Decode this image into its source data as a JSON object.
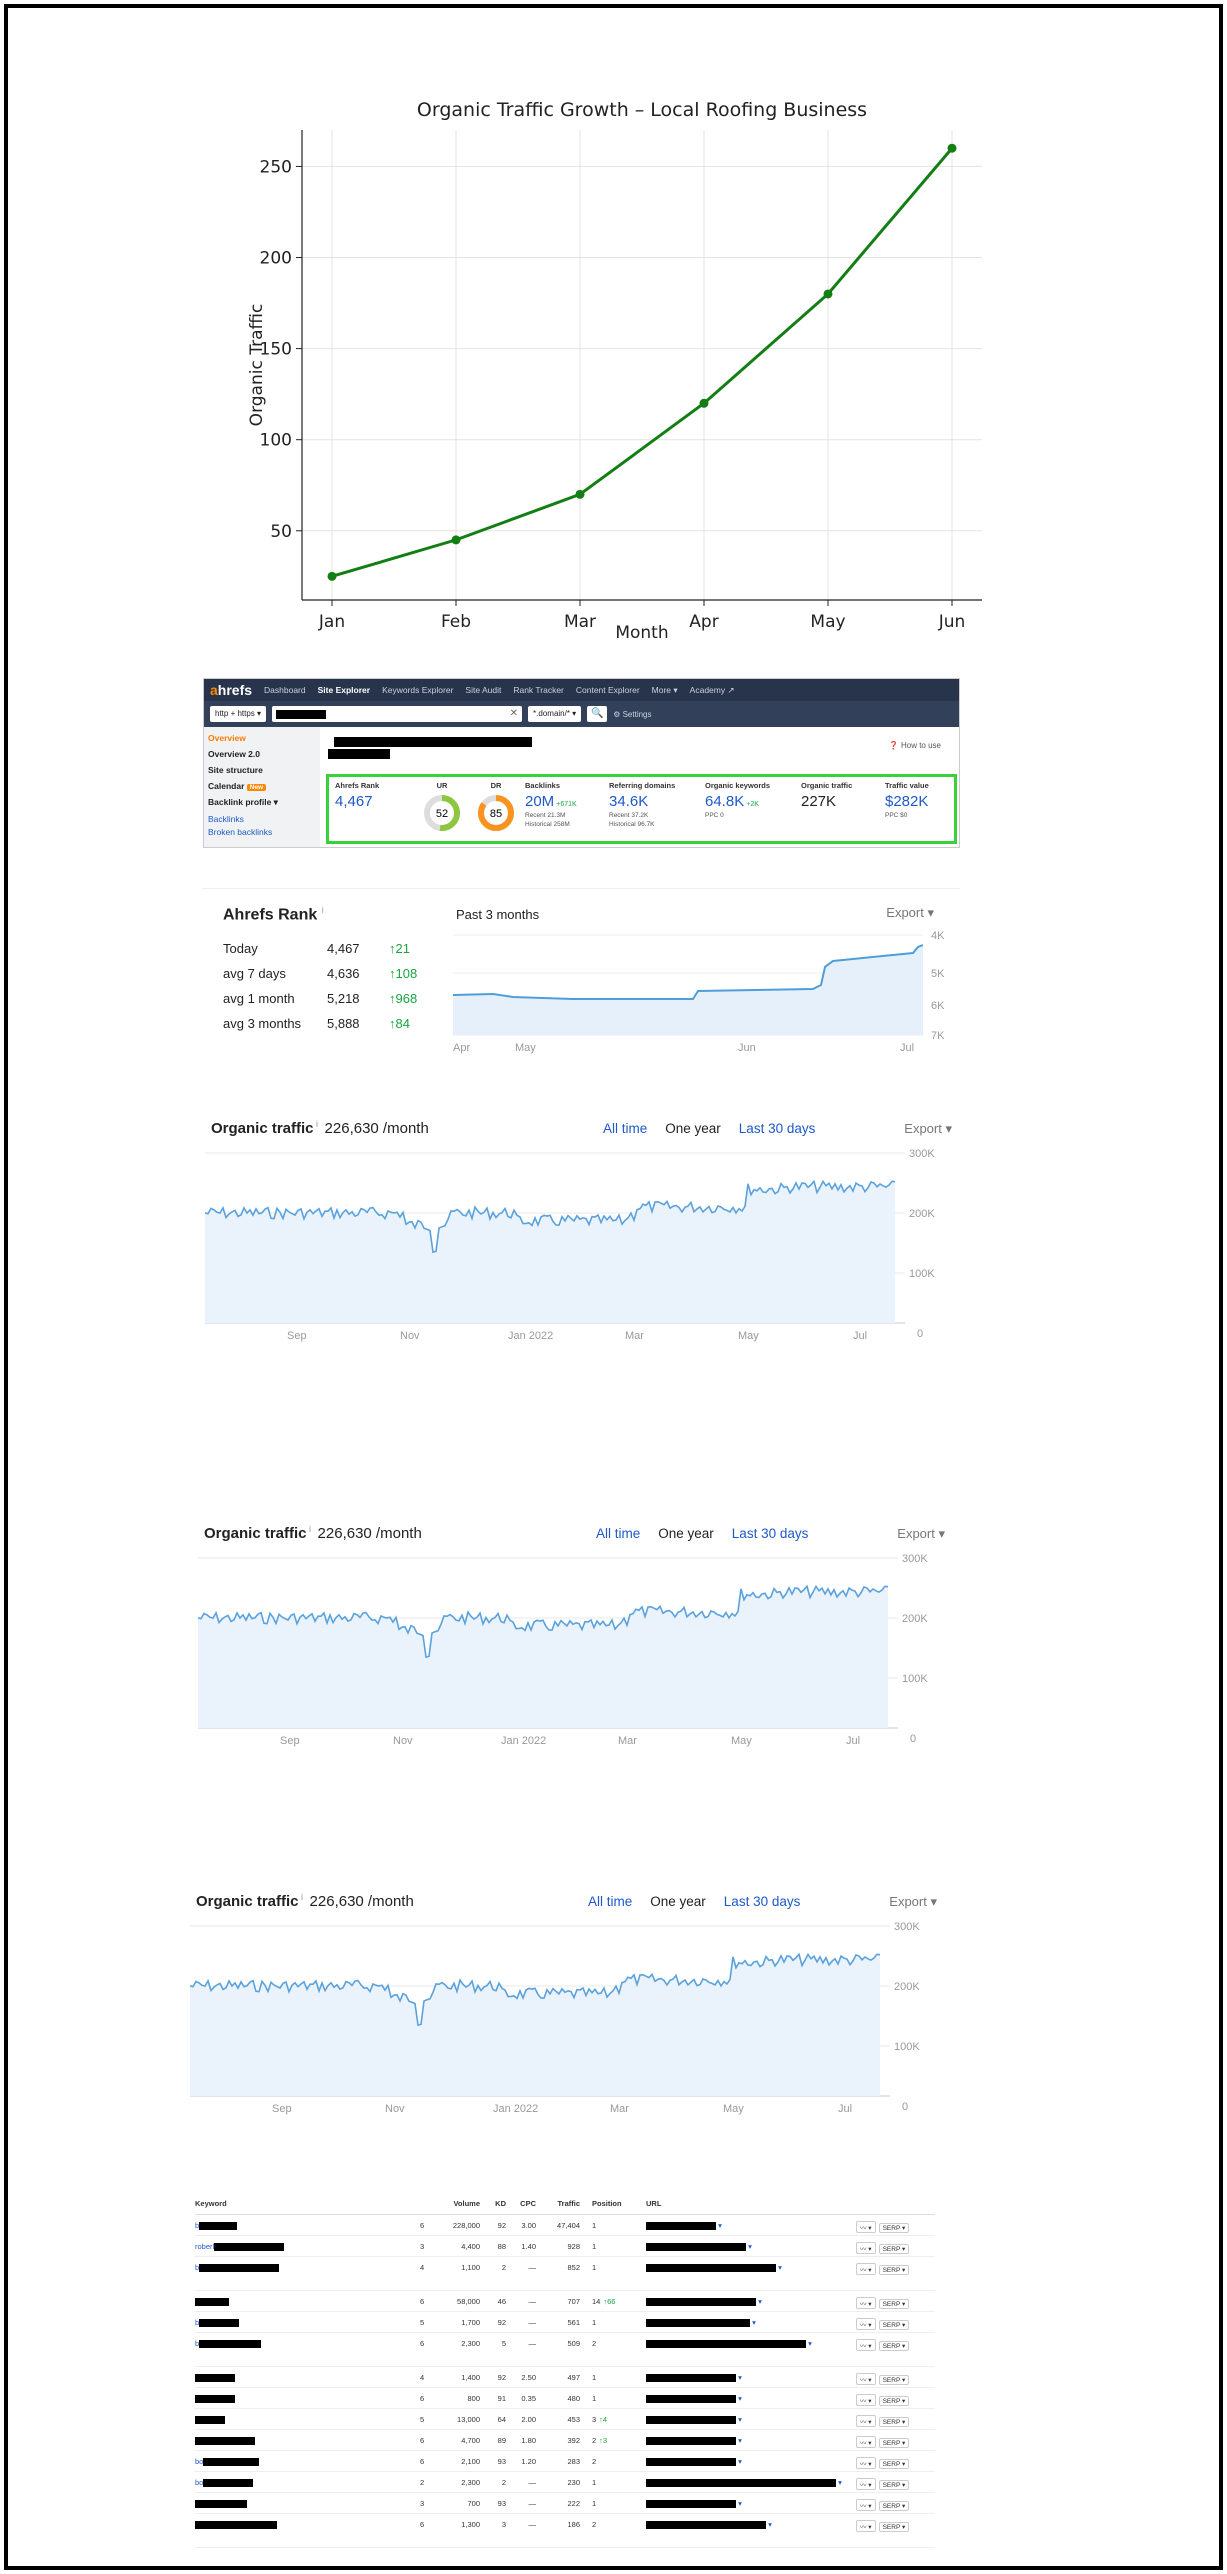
{
  "chart_data": {
    "type": "line",
    "title": "Organic Traffic Growth – Local Roofing Business",
    "xlabel": "Month",
    "ylabel": "Organic Traffic",
    "categories": [
      "Jan",
      "Feb",
      "Mar",
      "Apr",
      "May",
      "Jun"
    ],
    "values": [
      25,
      45,
      70,
      120,
      180,
      260
    ],
    "yticks": [
      50,
      100,
      150,
      200,
      250
    ],
    "ylim": [
      12,
      270
    ],
    "grid": true,
    "color": "#137e13"
  },
  "ahrefs": {
    "logo_a": "a",
    "logo_rest": "hrefs",
    "nav": [
      "Dashboard",
      "Site Explorer",
      "Keywords Explorer",
      "Site Audit",
      "Rank Tracker",
      "Content Explorer",
      "More ▾",
      "Academy ↗"
    ],
    "protocol": "http + https ▾",
    "mode": "*.domain/* ▾",
    "settings": "⚙ Settings",
    "how_to_use": "❓ How to use",
    "sidebar": [
      "Overview",
      "Overview 2.0",
      "Site structure",
      "Calendar",
      "Backlink profile ▾",
      "Backlinks",
      "Broken backlinks"
    ],
    "new_badge": "New",
    "metrics": {
      "ahrefs_rank": {
        "label": "Ahrefs Rank",
        "value": "4,467"
      },
      "ur": {
        "label": "UR",
        "value": "52"
      },
      "dr": {
        "label": "DR",
        "value": "85"
      },
      "backlinks": {
        "label": "Backlinks",
        "value": "20M",
        "delta": "+671K",
        "recent": "Recent 21.3M",
        "historical": "Historical 258M"
      },
      "ref_domains": {
        "label": "Referring domains",
        "value": "34.6K",
        "recent": "Recent 37.2K",
        "historical": "Historical 96.7K"
      },
      "org_keywords": {
        "label": "Organic keywords",
        "value": "64.8K",
        "delta": "+2K",
        "ppc": "PPC 0"
      },
      "org_traffic": {
        "label": "Organic traffic",
        "value": "227K"
      },
      "traffic_value": {
        "label": "Traffic value",
        "value": "$282K",
        "ppc": "PPC $0"
      }
    }
  },
  "rank": {
    "title": "Ahrefs Rank",
    "period": "Past 3 months",
    "export": "Export",
    "rows": [
      {
        "label": "Today",
        "value": "4,467",
        "delta": "↑21"
      },
      {
        "label": "avg 7 days",
        "value": "4,636",
        "delta": "↑108"
      },
      {
        "label": "avg 1 month",
        "value": "5,218",
        "delta": "↑968"
      },
      {
        "label": "avg 3 months",
        "value": "5,888",
        "delta": "↑84"
      }
    ],
    "x_ticks": [
      "Apr",
      "May",
      "Jun",
      "Jul"
    ],
    "y_ticks": [
      "4K",
      "5K",
      "6K",
      "7K"
    ]
  },
  "traffic": {
    "title": "Organic traffic",
    "value": "226,630 /month",
    "tabs": [
      "All time",
      "One year",
      "Last 30 days"
    ],
    "export": "Export",
    "x_ticks": [
      "Sep",
      "Nov",
      "Jan 2022",
      "Mar",
      "May",
      "Jul"
    ],
    "y_ticks": [
      "300K",
      "200K",
      "100K",
      "0"
    ]
  },
  "keywords": {
    "columns": [
      "Keyword",
      "Volume",
      "KD",
      "CPC",
      "Traffic",
      "Position",
      "URL"
    ],
    "serp_label": "SERP ▾",
    "rows": [
      {
        "kw": "b",
        "n": "6",
        "vol": "228,000",
        "kd": "92",
        "cpc": "3.00",
        "tr": "47,404",
        "pos": "1",
        "chg": ""
      },
      {
        "kw": "roberl",
        "n": "3",
        "vol": "4,400",
        "kd": "88",
        "cpc": "1.40",
        "tr": "928",
        "pos": "1",
        "chg": ""
      },
      {
        "kw": "b",
        "n": "4",
        "vol": "1,100",
        "kd": "2",
        "cpc": "—",
        "tr": "852",
        "pos": "1",
        "chg": ""
      },
      {
        "kw": "",
        "n": "6",
        "vol": "58,000",
        "kd": "46",
        "cpc": "—",
        "tr": "707",
        "pos": "14",
        "chg": "↑66"
      },
      {
        "kw": "b",
        "n": "5",
        "vol": "1,700",
        "kd": "92",
        "cpc": "—",
        "tr": "561",
        "pos": "1",
        "chg": ""
      },
      {
        "kw": "b",
        "n": "6",
        "vol": "2,300",
        "kd": "5",
        "cpc": "—",
        "tr": "509",
        "pos": "2",
        "chg": ""
      },
      {
        "kw": "",
        "n": "4",
        "vol": "1,400",
        "kd": "92",
        "cpc": "2.50",
        "tr": "497",
        "pos": "1",
        "chg": ""
      },
      {
        "kw": "",
        "n": "6",
        "vol": "800",
        "kd": "91",
        "cpc": "0.35",
        "tr": "480",
        "pos": "1",
        "chg": ""
      },
      {
        "kw": "",
        "n": "5",
        "vol": "13,000",
        "kd": "64",
        "cpc": "2.00",
        "tr": "453",
        "pos": "3",
        "chg": "↑4"
      },
      {
        "kw": "",
        "n": "6",
        "vol": "4,700",
        "kd": "89",
        "cpc": "1.80",
        "tr": "392",
        "pos": "2",
        "chg": "↑3"
      },
      {
        "kw": "bo",
        "n": "6",
        "vol": "2,100",
        "kd": "93",
        "cpc": "1.20",
        "tr": "283",
        "pos": "2",
        "chg": ""
      },
      {
        "kw": "bo",
        "n": "2",
        "vol": "2,300",
        "kd": "2",
        "cpc": "—",
        "tr": "230",
        "pos": "1",
        "chg": ""
      },
      {
        "kw": "",
        "n": "3",
        "vol": "700",
        "kd": "93",
        "cpc": "—",
        "tr": "222",
        "pos": "1",
        "chg": ""
      },
      {
        "kw": "",
        "n": "6",
        "vol": "1,300",
        "kd": "3",
        "cpc": "—",
        "tr": "186",
        "pos": "2",
        "chg": ""
      }
    ]
  }
}
